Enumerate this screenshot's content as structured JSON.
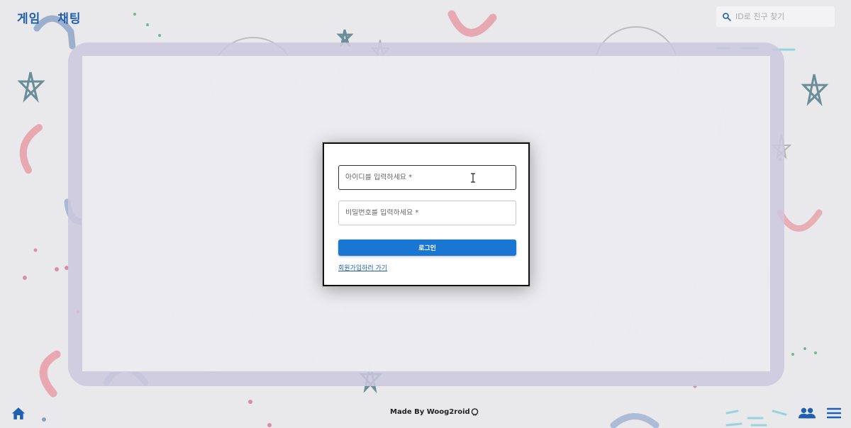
{
  "nav": {
    "game_label": "게임",
    "chat_label": "채팅"
  },
  "search": {
    "placeholder": "ID로 친구 찾기"
  },
  "login": {
    "id_placeholder": "아이디를 입력하세요 *",
    "password_placeholder": "비밀번호를 입력하세요 *",
    "login_label": "로그인",
    "signup_link": "회원가입하러 가기"
  },
  "footer": {
    "credit": "Made By Woog2roid"
  },
  "colors": {
    "accent": "#1976d2",
    "nav_text": "#1f5fb0",
    "background": "#e9e8ea",
    "frame": "#cdc8de"
  },
  "icons": [
    "search-icon",
    "text-cursor-icon",
    "github-icon",
    "home-icon",
    "friends-icon",
    "menu-icon"
  ]
}
